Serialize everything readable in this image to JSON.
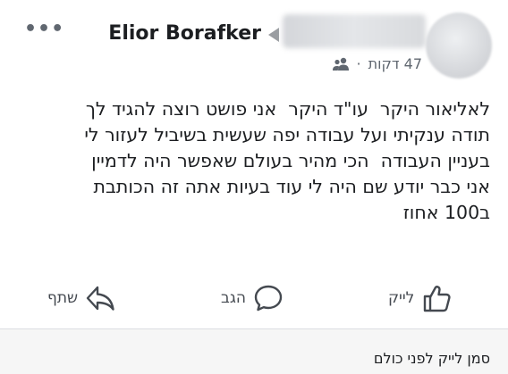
{
  "post": {
    "author": "Elior Borafker",
    "time": "47 דקות",
    "separator": "·",
    "audience_icon": "friends-icon",
    "text": "לאליאור היקר  עו\"ד היקר  אני פושט רוצה להגיד לך\nתודה ענקיתי ועל עבודה יפה שעשית בשיביל לעזור לי\nבעניין העבודה  הכי מהיר בעולם שאפשר היה לדמיין\nאני כבר יודע שם היה לי עוד בעיות אתה זה הכותבת\nב100 אחוז"
  },
  "actions": {
    "like": "לייק",
    "comment": "הגב",
    "share": "שתף"
  },
  "footer": {
    "likes_text": "סמן לייק לפני כולם"
  },
  "icons": {
    "more": "more-options-icon",
    "like": "thumbs-up-icon",
    "comment": "comment-bubble-icon",
    "share": "share-arrow-icon"
  },
  "colors": {
    "icon_gray": "#444950",
    "text": "#1c1e21",
    "meta": "#606770"
  }
}
